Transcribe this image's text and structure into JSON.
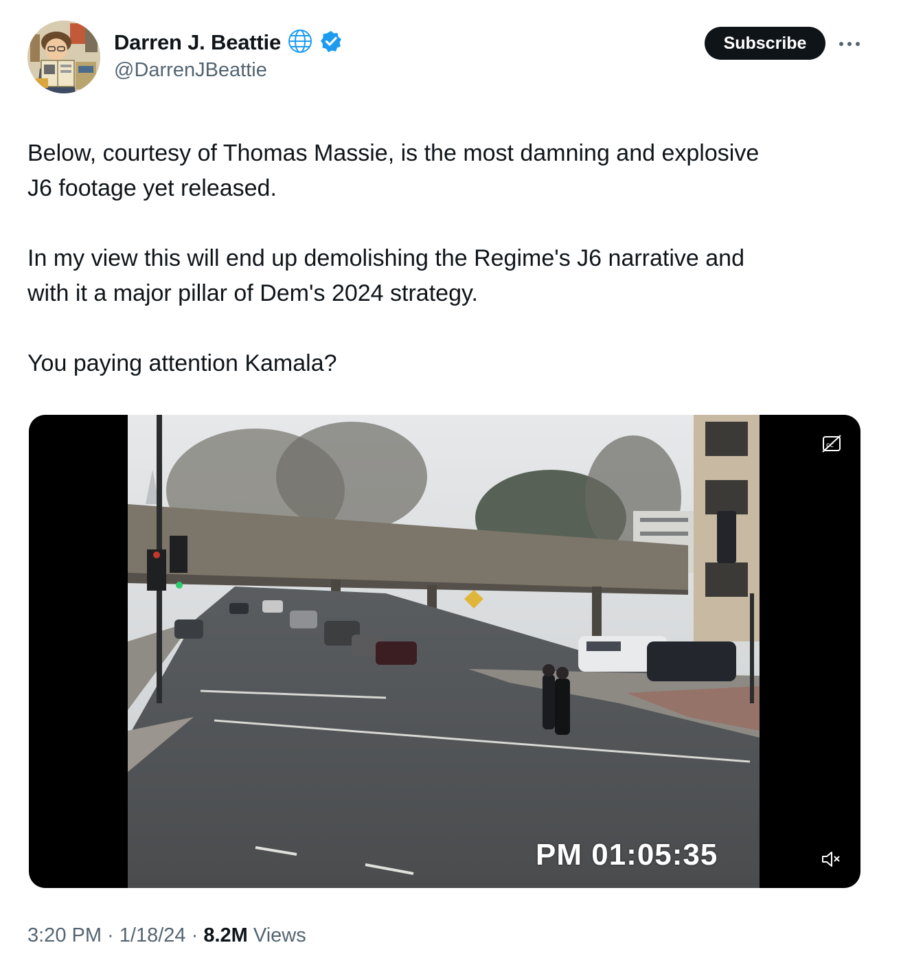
{
  "author": {
    "display_name": "Darren J. Beattie",
    "handle": "@DarrenJBeattie",
    "badges": [
      "globe-icon",
      "verified-badge-icon"
    ],
    "verified_color": "#1d9bf0"
  },
  "actions": {
    "subscribe_label": "Subscribe",
    "more_icon": "more-dots-icon"
  },
  "tweet": {
    "paragraphs": [
      [
        "Below, courtesy of Thomas Massie, is the most damning and explosive",
        "J6 footage yet released."
      ],
      [
        "In my view this will end up demolishing the Regime's J6 narrative and",
        "with it a major pillar of Dem's 2024 strategy."
      ],
      [
        "You paying attention Kamala?"
      ]
    ]
  },
  "video": {
    "timestamp_overlay": "PM 01:05:35",
    "controls": [
      "closed-captions-icon",
      "muted-volume-icon"
    ]
  },
  "meta": {
    "time": "3:20 PM",
    "separator": " · ",
    "date": "1/18/24",
    "views_count": "8.2M",
    "views_label": " Views"
  },
  "colors": {
    "text_primary": "#0f1419",
    "text_secondary": "#536471",
    "button_bg": "#0f1419",
    "accent": "#1d9bf0"
  }
}
